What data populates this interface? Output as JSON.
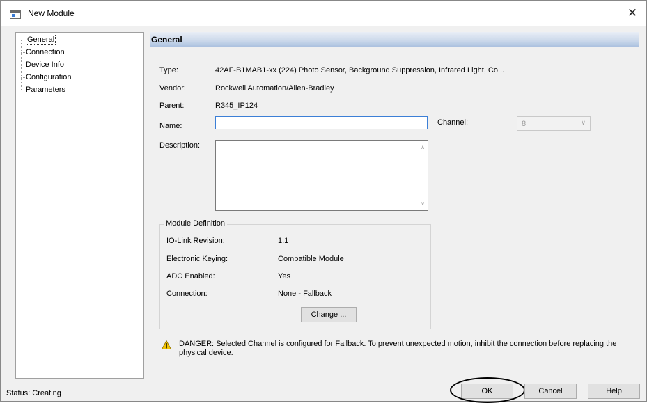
{
  "window": {
    "title": "New Module",
    "close_glyph": "✕"
  },
  "tree": {
    "items": [
      {
        "label": "General",
        "selected": true
      },
      {
        "label": "Connection"
      },
      {
        "label": "Device Info"
      },
      {
        "label": "Configuration"
      },
      {
        "label": "Parameters"
      }
    ]
  },
  "general": {
    "header": "General",
    "type_label": "Type:",
    "type_value": "42AF-B1MAB1-xx (224) Photo Sensor, Background Suppression, Infrared Light, Co...",
    "vendor_label": "Vendor:",
    "vendor_value": "Rockwell Automation/Allen-Bradley",
    "parent_label": "Parent:",
    "parent_value": "R345_IP124",
    "name_label": "Name:",
    "name_value": "",
    "channel_label": "Channel:",
    "channel_value": "8",
    "description_label": "Description:",
    "description_value": ""
  },
  "module_definition": {
    "legend": "Module Definition",
    "rows": [
      {
        "label": "IO-Link Revision:",
        "value": "1.1"
      },
      {
        "label": "Electronic Keying:",
        "value": "Compatible Module"
      },
      {
        "label": "ADC Enabled:",
        "value": "Yes"
      },
      {
        "label": "Connection:",
        "value": "None - Fallback"
      }
    ],
    "change_button": "Change ..."
  },
  "danger_message": "DANGER: Selected Channel is configured for Fallback. To prevent unexpected motion, inhibit the connection before replacing the physical device.",
  "status": {
    "text": "Status:  Creating"
  },
  "buttons": {
    "ok": "OK",
    "cancel": "Cancel",
    "help": "Help"
  },
  "colors": {
    "header_gradient_end": "#a7bede",
    "focus_border": "#3c7fd6",
    "warning_yellow": "#f2c300"
  },
  "icons": {
    "app": "module-window-icon",
    "close": "close-icon",
    "warning": "warning-icon"
  }
}
